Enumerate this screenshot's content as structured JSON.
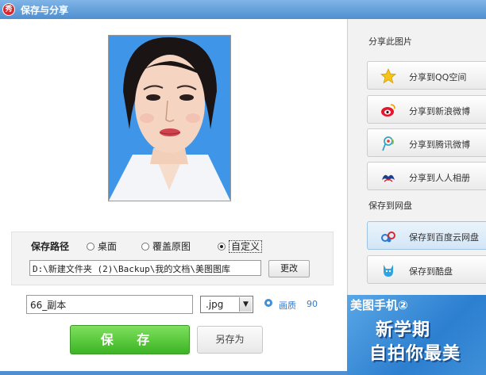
{
  "window": {
    "title": "保存与分享",
    "app_icon_text": "秀"
  },
  "photo": {
    "icon": "portrait-photo",
    "background_color": "#3f95e8"
  },
  "save_path": {
    "label": "保存路径",
    "options": [
      {
        "label": "桌面",
        "selected": false
      },
      {
        "label": "覆盖原图",
        "selected": false
      },
      {
        "label": "自定义",
        "selected": true
      }
    ],
    "path_value": "D:\\新建文件夹 (2)\\Backup\\我的文档\\美图图库",
    "change_button": "更改"
  },
  "file": {
    "name_value": "66_副本",
    "format_value": ".jpg",
    "quality_label": "画质",
    "quality_value": "90"
  },
  "actions": {
    "save_label": "保 存",
    "save_as_label": "另存为"
  },
  "share": {
    "section_title": "分享此图片",
    "items": [
      {
        "label": "分享到QQ空间",
        "icon": "star-icon"
      },
      {
        "label": "分享到新浪微博",
        "icon": "weibo-icon"
      },
      {
        "label": "分享到腾讯微博",
        "icon": "tencent-weibo-icon"
      },
      {
        "label": "分享到人人相册",
        "icon": "renren-icon"
      }
    ]
  },
  "cloud": {
    "section_title": "保存到网盘",
    "items": [
      {
        "label": "保存到百度云网盘",
        "icon": "baidu-cloud-icon"
      },
      {
        "label": "保存到酷盘",
        "icon": "kupan-icon"
      }
    ]
  },
  "ad": {
    "title": "美图手机②",
    "line1": "新学期",
    "line2": "自拍你最美"
  },
  "colors": {
    "title_bar": "#4f8fd0",
    "save_button": "#3bb424",
    "accent": "#3a78c8"
  }
}
